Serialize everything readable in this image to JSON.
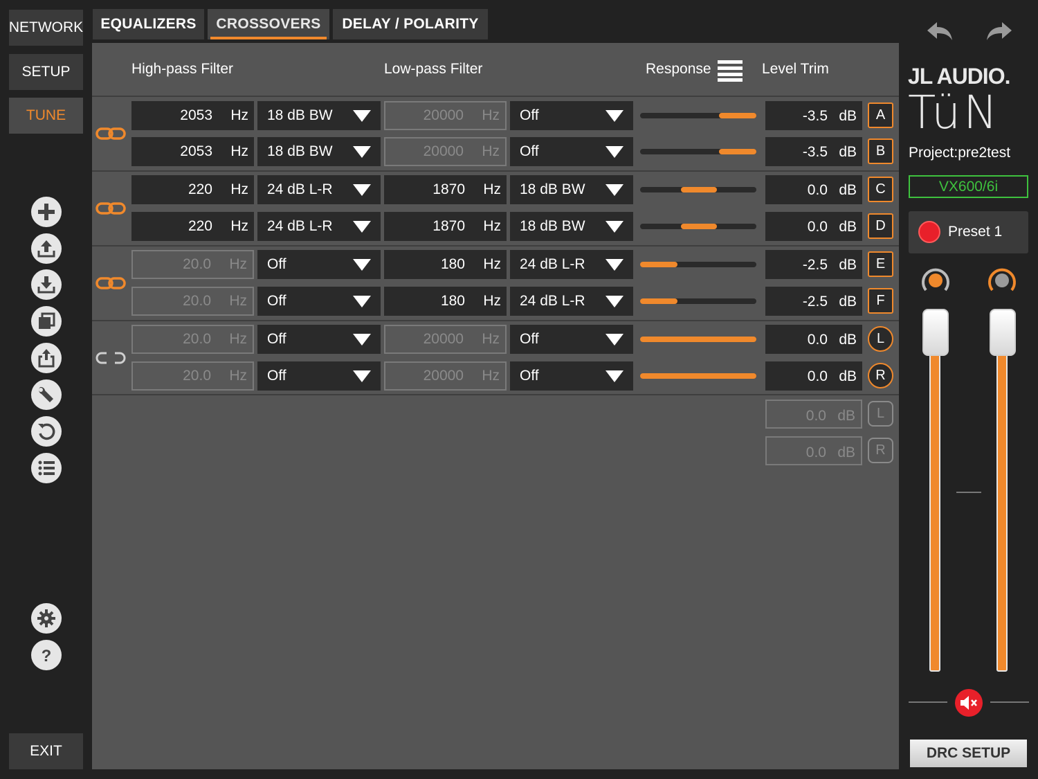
{
  "nav": {
    "network": "NETWORK",
    "setup": "SETUP",
    "tune": "TUNE",
    "exit": "EXIT"
  },
  "tabs": [
    "EQUALIZERS",
    "CROSSOVERS",
    "DELAY / POLARITY"
  ],
  "active_tab": "CROSSOVERS",
  "headers": {
    "highpass": "High-pass Filter",
    "lowpass": "Low-pass Filter",
    "response": "Response",
    "level": "Level Trim"
  },
  "units": {
    "hz": "Hz",
    "db": "dB"
  },
  "rows": [
    {
      "hp_freq": "2053",
      "hp_type": "18 dB BW",
      "lp_freq": "20000",
      "lp_type": "Off",
      "slider_fill": [
        0.68,
        1.0
      ],
      "level": "-3.5",
      "channel": "A"
    },
    {
      "hp_freq": "2053",
      "hp_type": "18 dB BW",
      "lp_freq": "20000",
      "lp_type": "Off",
      "slider_fill": [
        0.68,
        1.0
      ],
      "level": "-3.5",
      "channel": "B"
    },
    {
      "hp_freq": "220",
      "hp_type": "24 dB L-R",
      "lp_freq": "1870",
      "lp_type": "18 dB BW",
      "slider_fill": [
        0.35,
        0.66
      ],
      "level": "0.0",
      "channel": "C"
    },
    {
      "hp_freq": "220",
      "hp_type": "24 dB L-R",
      "lp_freq": "1870",
      "lp_type": "18 dB BW",
      "slider_fill": [
        0.35,
        0.66
      ],
      "level": "0.0",
      "channel": "D"
    },
    {
      "hp_freq": "20.0",
      "hp_type": "Off",
      "lp_freq": "180",
      "lp_type": "24 dB L-R",
      "slider_fill": [
        0.0,
        0.32
      ],
      "level": "-2.5",
      "channel": "E"
    },
    {
      "hp_freq": "20.0",
      "hp_type": "Off",
      "lp_freq": "180",
      "lp_type": "24 dB L-R",
      "slider_fill": [
        0.0,
        0.32
      ],
      "level": "-2.5",
      "channel": "F"
    },
    {
      "hp_freq": "20.0",
      "hp_type": "Off",
      "lp_freq": "20000",
      "lp_type": "Off",
      "slider_fill": [
        0.0,
        1.0
      ],
      "level": "0.0",
      "channel": "L"
    },
    {
      "hp_freq": "20.0",
      "hp_type": "Off",
      "lp_freq": "20000",
      "lp_type": "Off",
      "slider_fill": [
        0.0,
        1.0
      ],
      "level": "0.0",
      "channel": "R"
    }
  ],
  "extra_levels": [
    {
      "level": "0.0",
      "channel": "L"
    },
    {
      "level": "0.0",
      "channel": "R"
    }
  ],
  "right": {
    "brand": "JL AUDIO.",
    "product": "TüN",
    "project": "Project:pre2test",
    "device": "VX600/6i",
    "preset": "Preset 1",
    "drc": "DRC SETUP"
  },
  "colors": {
    "accent": "#f0892c",
    "device_green": "#3ec23e",
    "preset_red": "#e8202a",
    "mute_red": "#e8202a"
  }
}
